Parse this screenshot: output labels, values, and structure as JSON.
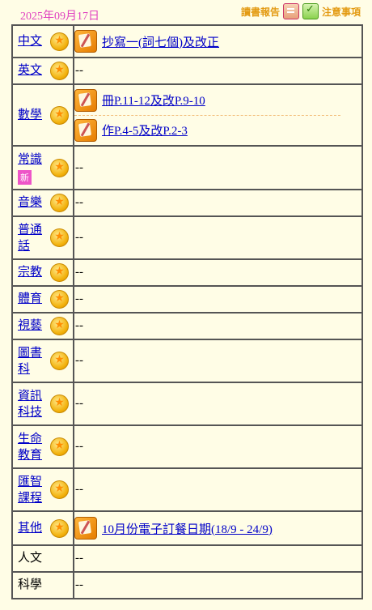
{
  "header": {
    "date": "2025年09月17日",
    "report_label": "讀書報告",
    "notes_label": "注意事項"
  },
  "icons": {
    "subject": "star-icon",
    "homework": "homework-pencil-icon",
    "report": "report-icon",
    "notes": "notes-check-icon"
  },
  "colors": {
    "background": "#fffde6",
    "date": "#e040c0",
    "link": "#0000c8",
    "top_link": "#e39a12",
    "new_badge": "#ee55c8"
  },
  "rows": [
    {
      "subject": "中文",
      "items": [
        "抄寫一(詞七個)及改正"
      ]
    },
    {
      "subject": "英文",
      "empty": "--"
    },
    {
      "subject": "數學",
      "items": [
        "冊P.11-12及改P.9-10",
        "作P.4-5及改P.2-3"
      ]
    },
    {
      "subject": "常識",
      "badge": "新",
      "empty": "--"
    },
    {
      "subject": "音樂",
      "empty": "--"
    },
    {
      "subject": "普通話",
      "empty": "--"
    },
    {
      "subject": "宗教",
      "empty": "--"
    },
    {
      "subject": "體育",
      "empty": "--"
    },
    {
      "subject": "視藝",
      "empty": "--"
    },
    {
      "subject": "圖書科",
      "empty": "--"
    },
    {
      "subject": "資訊科技",
      "empty": "--"
    },
    {
      "subject": "生命教育",
      "empty": "--"
    },
    {
      "subject": "匯智課程",
      "empty": "--"
    },
    {
      "subject": "其他",
      "items": [
        "10月份電子訂餐日期(18/9 - 24/9)"
      ]
    },
    {
      "subject": "人文",
      "empty": "--"
    },
    {
      "subject": "科學",
      "empty": "--"
    }
  ]
}
